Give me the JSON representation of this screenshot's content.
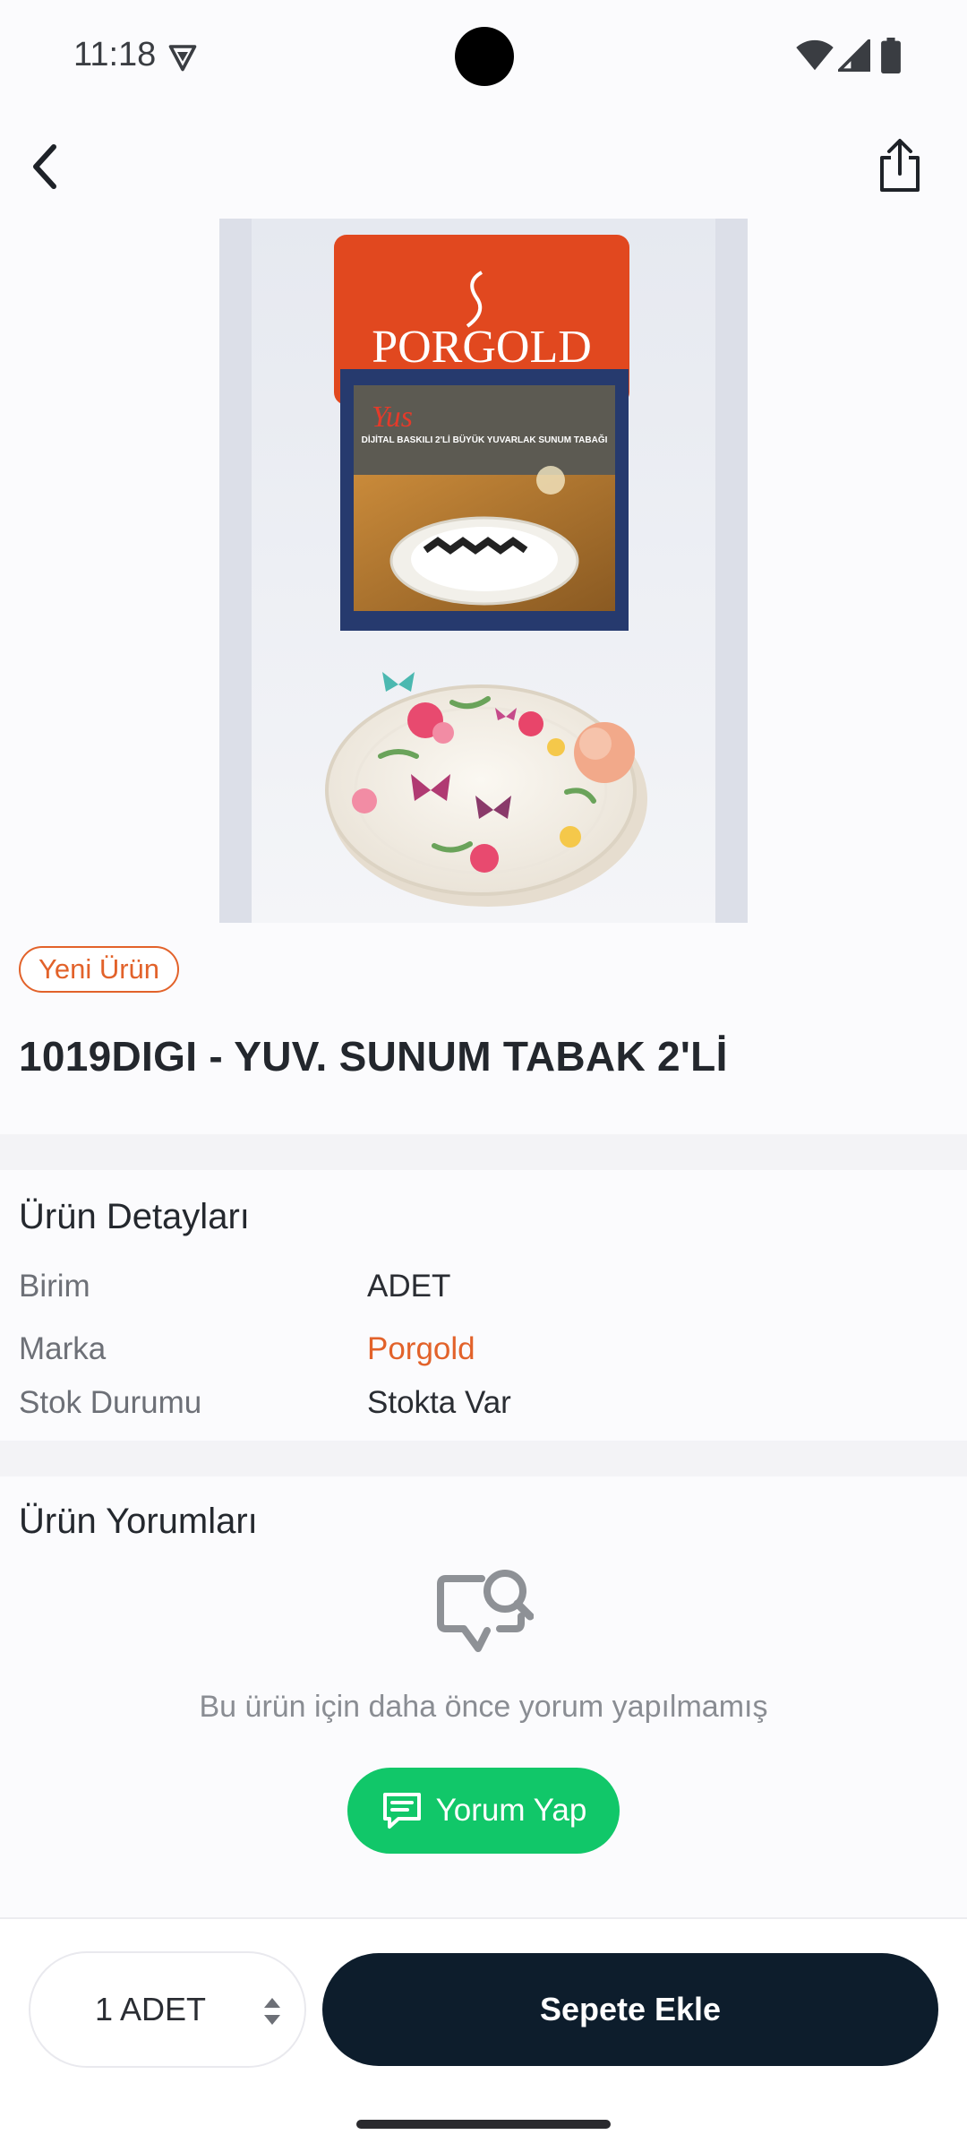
{
  "status_bar": {
    "time": "11:18"
  },
  "product": {
    "badge": "Yeni Ürün",
    "title": "1019DIGI - YUV. SUNUM TABAK 2'Lİ",
    "image": {
      "box_brand": "PORGOLD",
      "inner_label": "Yus",
      "inner_text": "DİJİTAL BASKILI 2'Lİ BÜYÜK YUVARLAK SUNUM TABAĞI"
    }
  },
  "details": {
    "title": "Ürün Detayları",
    "rows": [
      {
        "label": "Birim",
        "value": "ADET"
      },
      {
        "label": "Marka",
        "value": "Porgold"
      },
      {
        "label": "Stok Durumu",
        "value": "Stokta Var"
      }
    ]
  },
  "reviews": {
    "title": "Ürün Yorumları",
    "empty_text": "Bu ürün için daha önce yorum yapılmamış",
    "button_label": "Yorum Yap"
  },
  "bottom_bar": {
    "quantity": "1 ADET",
    "add_to_cart": "Sepete Ekle"
  },
  "colors": {
    "accent_orange": "#e2622a",
    "review_green": "#11c769",
    "cart_dark": "#0d1d2c"
  }
}
